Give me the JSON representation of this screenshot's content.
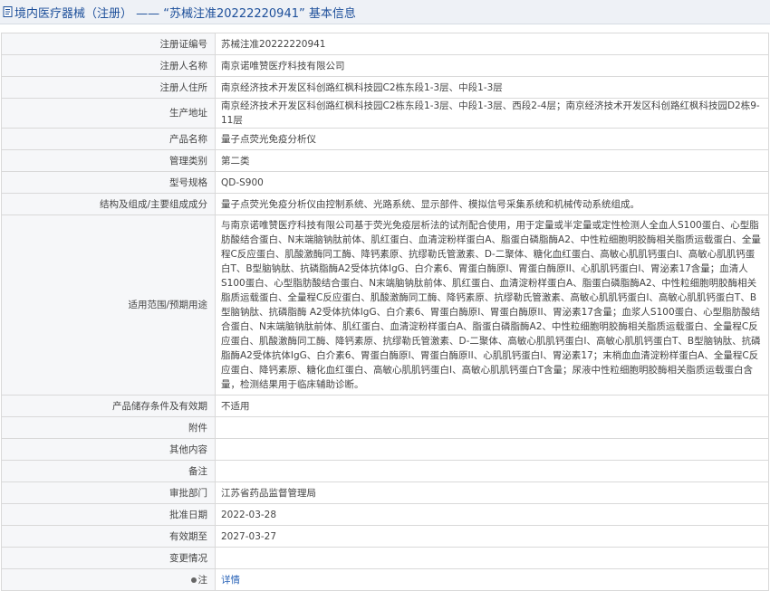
{
  "header": {
    "title": "境内医疗器械（注册） —— “苏械注准20222220941” 基本信息"
  },
  "fields": [
    {
      "label": "注册证编号",
      "value": "苏械注准20222220941"
    },
    {
      "label": "注册人名称",
      "value": "南京诺唯赞医疗科技有限公司"
    },
    {
      "label": "注册人住所",
      "value": "南京经济技术开发区科创路红枫科技园C2栋东段1-3层、中段1-3层"
    },
    {
      "label": "生产地址",
      "value": "南京经济技术开发区科创路红枫科技园C2栋东段1-3层、中段1-3层、西段2-4层；南京经济技术开发区科创路红枫科技园D2栋9-11层"
    },
    {
      "label": "产品名称",
      "value": "量子点荧光免疫分析仪"
    },
    {
      "label": "管理类别",
      "value": "第二类"
    },
    {
      "label": "型号规格",
      "value": "QD-S900"
    },
    {
      "label": "结构及组成/主要组成成分",
      "value": "量子点荧光免疫分析仪由控制系统、光路系统、显示部件、模拟信号采集系统和机械传动系统组成。"
    },
    {
      "label": "适用范围/预期用途",
      "value": "与南京诺唯赞医疗科技有限公司基于荧光免疫层析法的试剂配合使用，用于定量或半定量或定性检测人全血人S100蛋白、心型脂肪酸结合蛋白、N末端脑钠肽前体、肌红蛋白、血清淀粉样蛋白A、脂蛋白磷脂酶A2、中性粒细胞明胶酶相关脂质运载蛋白、全量程C反应蛋白、肌酸激酶同工酶、降钙素原、抗缪勒氏管激素、D-二聚体、糖化血红蛋白、高敏心肌肌钙蛋白I、高敏心肌肌钙蛋白T、B型脑钠肽、抗磷脂酶A2受体抗体IgG、白介素6、胃蛋白酶原I、胃蛋白酶原II、心肌肌钙蛋白Ⅰ、胃泌素17含量；血清人S100蛋白、心型脂肪酸结合蛋白、N末端脑钠肽前体、肌红蛋白、血清淀粉样蛋白A、脂蛋白磷脂酶A2、中性粒细胞明胶酶相关脂质运载蛋白、全量程C反应蛋白、肌酸激酶同工酶、降钙素原、抗缪勒氏管激素、高敏心肌肌钙蛋白I、高敏心肌肌钙蛋白T、B型脑钠肽、抗磷脂酶 A2受体抗体IgG、白介素6、胃蛋白酶原I、胃蛋白酶原II、胃泌素17含量；血浆人S100蛋白、心型脂肪酸结合蛋白、N末端脑钠肽前体、肌红蛋白、血清淀粉样蛋白A、脂蛋白磷脂酶A2、中性粒细胞明胶酶相关脂质运载蛋白、全量程C反应蛋白、肌酸激酶同工酶、降钙素原、抗缪勒氏管激素、D-二聚体、高敏心肌肌钙蛋白I、高敏心肌肌钙蛋白T、B型脑钠肽、抗磷脂酶A2受体抗体IgG、白介素6、胃蛋白酶原I、胃蛋白酶原II、心肌肌钙蛋白Ⅰ、胃泌素17；末梢血血清淀粉样蛋白A、全量程C反应蛋白、降钙素原、糖化血红蛋白、高敏心肌肌钙蛋白I、高敏心肌肌钙蛋白T含量；尿液中性粒细胞明胶酶相关脂质运载蛋白含量，检测结果用于临床辅助诊断。"
    },
    {
      "label": "产品储存条件及有效期",
      "value": "不适用"
    },
    {
      "label": "附件",
      "value": ""
    },
    {
      "label": "其他内容",
      "value": ""
    },
    {
      "label": "备注",
      "value": ""
    },
    {
      "label": "审批部门",
      "value": "江苏省药品监督管理局"
    },
    {
      "label": "批准日期",
      "value": "2022-03-28"
    },
    {
      "label": "有效期至",
      "value": "2027-03-27"
    },
    {
      "label": "变更情况",
      "value": ""
    }
  ],
  "note_row": {
    "label": "注",
    "link": "详情"
  }
}
